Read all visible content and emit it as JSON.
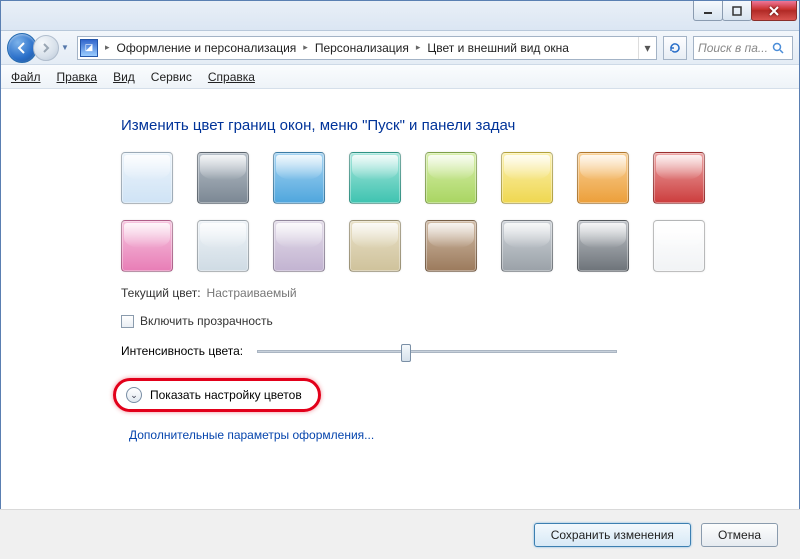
{
  "titlebar": {
    "minimize": "–",
    "maximize": "□",
    "close": "×"
  },
  "breadcrumbs": {
    "items": [
      "Оформление и персонализация",
      "Персонализация",
      "Цвет и внешний вид окна"
    ]
  },
  "search": {
    "placeholder": "Поиск в па..."
  },
  "menu": {
    "file": "Файл",
    "edit": "Правка",
    "view": "Вид",
    "tools": "Сервис",
    "help": "Справка"
  },
  "heading": "Изменить цвет границ окон, меню \"Пуск\" и панели задач",
  "swatches": [
    {
      "name": "sky",
      "bg": "linear-gradient(#ecf4fb,#cfe3f5)"
    },
    {
      "name": "graphite",
      "bg": "linear-gradient(#b7c0c9,#7b8793)"
    },
    {
      "name": "blue",
      "bg": "linear-gradient(#a6d4f2,#4fa6dd)"
    },
    {
      "name": "teal",
      "bg": "linear-gradient(#a8e6dc,#3ec3b0)"
    },
    {
      "name": "lime",
      "bg": "linear-gradient(#d7efab,#a9d562)"
    },
    {
      "name": "yellow",
      "bg": "linear-gradient(#fbf1b0,#efd750)"
    },
    {
      "name": "orange",
      "bg": "linear-gradient(#f9d29a,#ec9f3a)"
    },
    {
      "name": "red",
      "bg": "linear-gradient(#eca5a5,#cc3d3d)"
    },
    {
      "name": "pink",
      "bg": "linear-gradient(#f6c6e0,#e87db6)"
    },
    {
      "name": "frost",
      "bg": "linear-gradient(#eef3f7,#cfdbe4)"
    },
    {
      "name": "lavender",
      "bg": "linear-gradient(#e3dce9,#c2b3d1)"
    },
    {
      "name": "sand",
      "bg": "linear-gradient(#e9e1c8,#cfc29b)"
    },
    {
      "name": "chocolate",
      "bg": "linear-gradient(#d1bca7,#9b7a5c)"
    },
    {
      "name": "slate",
      "bg": "linear-gradient(#cfd4d9,#9aa1a8)"
    },
    {
      "name": "charcoal",
      "bg": "linear-gradient(#bfc3c8,#6d7379)"
    },
    {
      "name": "white",
      "bg": "linear-gradient(#ffffff,#f1f3f5)"
    }
  ],
  "current": {
    "label": "Текущий цвет:",
    "value": "Настраиваемый"
  },
  "transparency": {
    "label": "Включить прозрачность"
  },
  "intensity": {
    "label": "Интенсивность цвета:"
  },
  "expander": {
    "label": "Показать настройку цветов"
  },
  "advanced_link": "Дополнительные параметры оформления...",
  "buttons": {
    "save": "Сохранить изменения",
    "cancel": "Отмена"
  }
}
